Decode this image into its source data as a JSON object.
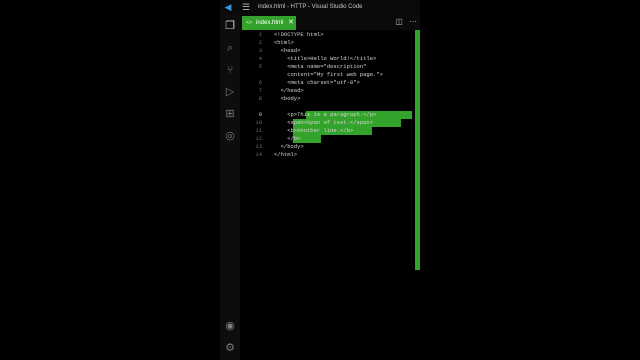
{
  "window": {
    "title": "index.html - HTTP - Visual Studio Code"
  },
  "tab": {
    "label": "index.html",
    "icon": "<>",
    "close": "✕"
  },
  "lines": [
    {
      "n": "1",
      "text": "<!DOCTYPE html>"
    },
    {
      "n": "2",
      "text": "<html>"
    },
    {
      "n": "3",
      "text": "  <head>"
    },
    {
      "n": "4",
      "text": "    <title>Hello World!</title>"
    },
    {
      "n": "5",
      "text": "    <meta name=\"description\""
    },
    {
      "n": "",
      "text": "    content=\"My first web page.\">"
    },
    {
      "n": "6",
      "text": "    <meta charset=\"utf-8\">"
    },
    {
      "n": "7",
      "text": "  </head>"
    },
    {
      "n": "8",
      "text": "  <body>"
    },
    {
      "n": "9",
      "text": "    <p>This is a paragraph.</p>"
    },
    {
      "n": "10",
      "text": "    <span>Span of text.</span>"
    },
    {
      "n": "11",
      "text": "    <b>Another line.</b>"
    },
    {
      "n": "12",
      "text": "    </b>"
    },
    {
      "n": "13",
      "text": "  </body>"
    },
    {
      "n": "14",
      "text": "</html>"
    }
  ],
  "colors": {
    "accent": "#33a32b",
    "background": "#000000",
    "text": "#d6d6d6"
  }
}
